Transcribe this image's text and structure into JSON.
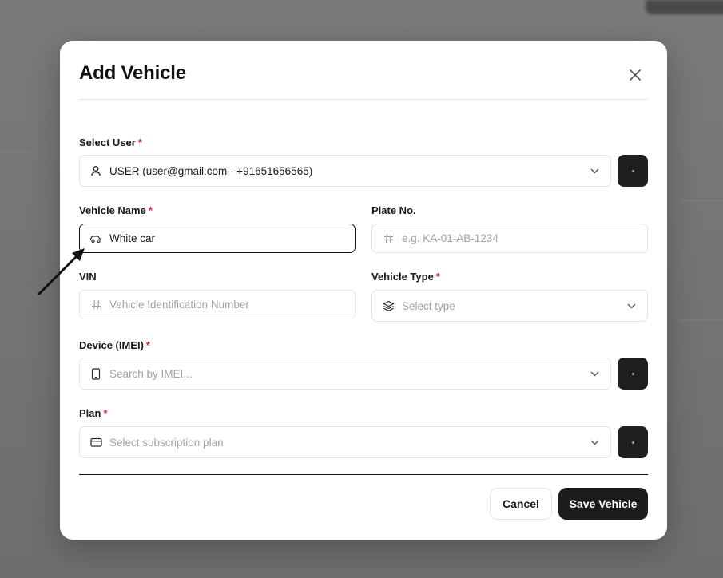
{
  "modal": {
    "title": "Add Vehicle",
    "close_icon": "close-icon"
  },
  "form": {
    "select_user": {
      "label": "Select User",
      "required_mark": "*",
      "value": "USER (user@gmail.com - +91651656565)",
      "icon": "user-icon"
    },
    "vehicle_name": {
      "label": "Vehicle Name",
      "required_mark": "*",
      "value": "White car",
      "icon": "car-icon"
    },
    "plate_no": {
      "label": "Plate No.",
      "placeholder": "e.g. KA-01-AB-1234",
      "icon": "hash-icon"
    },
    "vin": {
      "label": "VIN",
      "placeholder": "Vehicle Identification Number",
      "icon": "hash-icon"
    },
    "vehicle_type": {
      "label": "Vehicle Type",
      "required_mark": "*",
      "placeholder": "Select type",
      "icon": "layers-icon"
    },
    "device_imei": {
      "label": "Device (IMEI)",
      "required_mark": "*",
      "placeholder": "Search by IMEI...",
      "icon": "phone-icon"
    },
    "plan": {
      "label": "Plan",
      "required_mark": "*",
      "placeholder": "Select subscription plan",
      "icon": "credit-card-icon"
    }
  },
  "footer": {
    "cancel_label": "Cancel",
    "save_label": "Save Vehicle"
  },
  "colors": {
    "accent_dark": "#1c1c1f",
    "required": "#e11d2a",
    "border": "#e4e4e7",
    "placeholder": "#a1a1aa"
  }
}
